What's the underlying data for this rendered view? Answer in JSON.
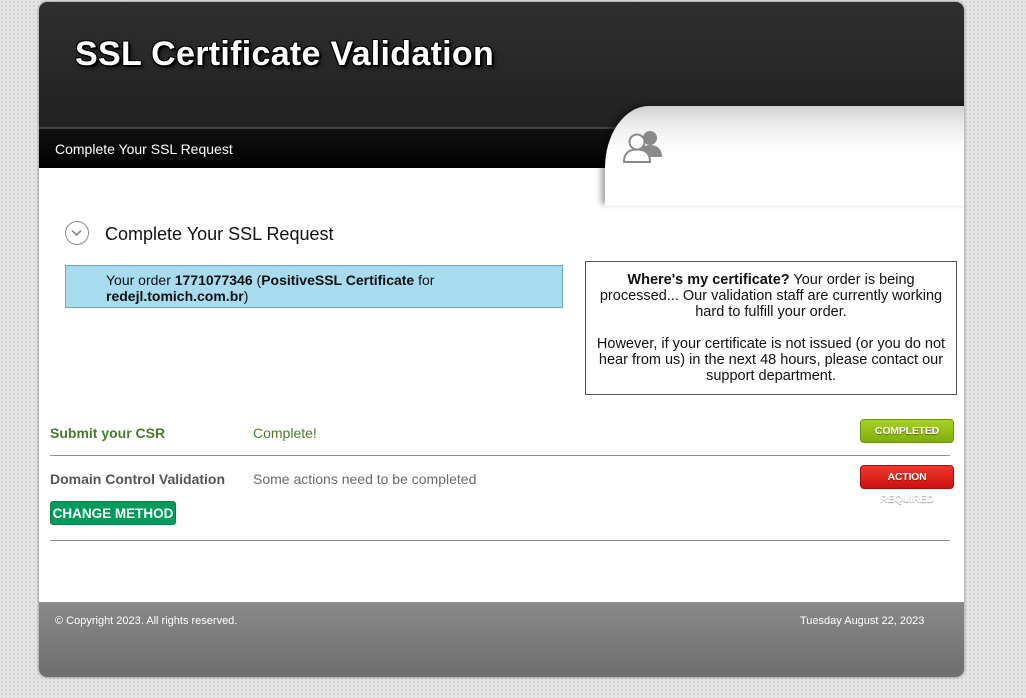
{
  "header": {
    "site_title": "SSL Certificate Validation",
    "subheader_label": "Complete Your SSL Request",
    "header_icon": "users-icon"
  },
  "section": {
    "title": "Complete Your SSL Request",
    "toggle_icon": "chevron-down-icon"
  },
  "order": {
    "prefix": "Your order ",
    "number": "1771077346",
    "paren_open": " (",
    "product": "PositiveSSL Certificate",
    "for_text": " for",
    "domain": "redejl.tomich.com.br",
    "paren_close": ")"
  },
  "certificate_info": {
    "heading": "Where's my certificate?",
    "paragraph1": " Your order is being processed... Our validation staff are currently working hard to fulfill your order.",
    "paragraph2": "However, if your certificate is not issued (or you do not hear from us) in the next 48 hours, please contact our support department."
  },
  "steps": [
    {
      "name": "Submit your CSR",
      "status": "Complete!",
      "badge": "COMPLETED",
      "name_color": "#4a7a2c",
      "status_color": "#4a7a2c",
      "badge_color": "#8dbe14"
    },
    {
      "name": "Domain Control Validation",
      "status": "Some actions need to be completed",
      "badge": "ACTION REQUIRED",
      "name_color": "#555555",
      "status_color": "#6a6a6a",
      "badge_color": "#e0211a"
    }
  ],
  "change_method_label": "CHANGE METHOD",
  "footer": {
    "copyright": "© Copyright 2023. All rights reserved.",
    "date": "Tuesday August 22, 2023"
  }
}
